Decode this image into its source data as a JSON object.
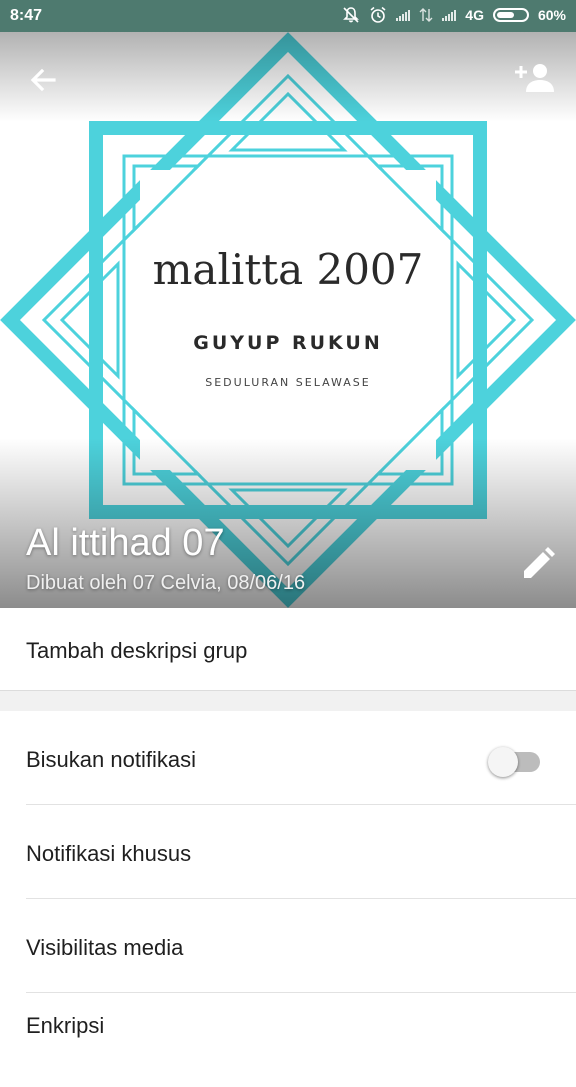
{
  "status_bar": {
    "time": "8:47",
    "network": "4G",
    "battery_percent": "60%",
    "battery_level": 0.6,
    "icons": [
      "mute-icon",
      "alarm-icon",
      "signal-icon",
      "data-icon",
      "signal-icon",
      "battery-icon"
    ]
  },
  "header": {
    "group_name": "Al ittihad 07",
    "created_by": "Dibuat oleh 07 Celvia, 08/06/16",
    "back_icon": "arrow-back-icon",
    "add_participant_icon": "person-add-icon",
    "edit_icon": "pencil-icon",
    "image": {
      "line1": "malitta 2007",
      "line2": "GUYUP RUKUN",
      "line3": "SEDULURAN SELAWASE",
      "accent_color": "#4dd2dc"
    }
  },
  "description": {
    "label": "Tambah deskripsi grup"
  },
  "settings": {
    "mute_label": "Bisukan notifikasi",
    "mute_enabled": false,
    "custom_notifications_label": "Notifikasi khusus",
    "media_visibility_label": "Visibilitas media",
    "encryption_label": "Enkripsi"
  },
  "colors": {
    "status_bar": "#4e7a6f",
    "toggle_off": "#bcbcbc"
  }
}
